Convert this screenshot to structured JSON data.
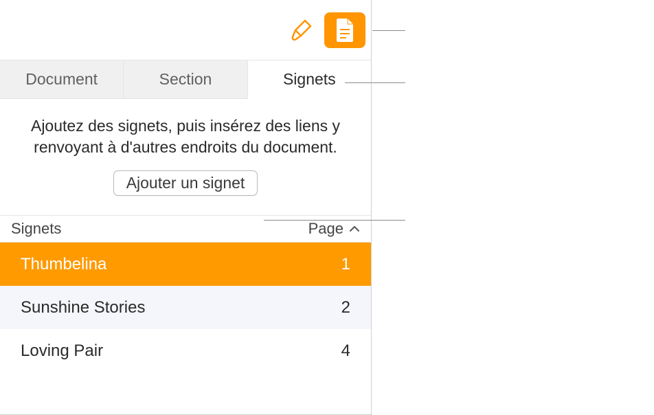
{
  "toolbar": {
    "format_icon": "format-brush",
    "document_icon": "document-page"
  },
  "tabs": {
    "document": "Document",
    "section": "Section",
    "bookmarks": "Signets"
  },
  "help_text": "Ajoutez des signets, puis insérez des liens y renvoyant à d'autres endroits du document.",
  "add_button": "Ajouter un signet",
  "list_header": {
    "name": "Signets",
    "page": "Page"
  },
  "bookmarks": [
    {
      "name": "Thumbelina",
      "page": "1",
      "selected": true
    },
    {
      "name": "Sunshine Stories",
      "page": "2",
      "selected": false
    },
    {
      "name": "Loving Pair",
      "page": "4",
      "selected": false
    }
  ]
}
